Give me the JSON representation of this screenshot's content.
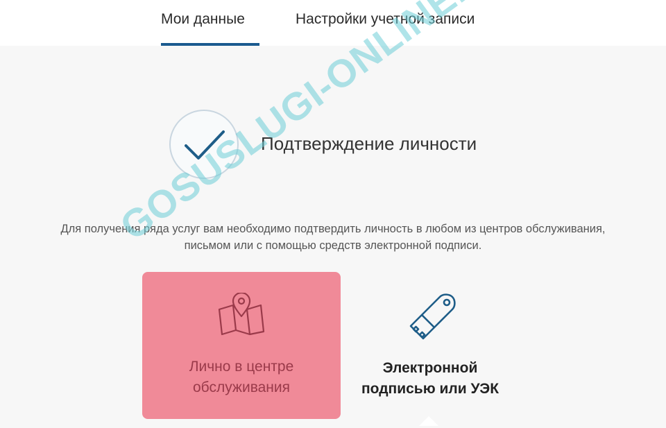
{
  "tabs": {
    "my_data": "Мои данные",
    "account_settings": "Настройки учетной записи"
  },
  "section": {
    "title": "Подтверждение личности"
  },
  "description": {
    "line1": "Для получения ряда услуг вам необходимо подтвердить личность в любом из центров обслуживания,",
    "line2": "письмом или с помощью средств электронной подписи."
  },
  "options": {
    "in_person": {
      "line1": "Лично в центре",
      "line2": "обслуживания",
      "icon": "map-pin-icon"
    },
    "e_signature": {
      "line1": "Электронной",
      "line2": "подписью или УЭК",
      "icon": "usb-token-icon"
    }
  },
  "watermark": "GOSUSLUGI-ONLINE.RU",
  "colors": {
    "tab_underline": "#1a5a8f",
    "selected_card": "#f08a98",
    "icon_stroke": "#1e5d88"
  }
}
